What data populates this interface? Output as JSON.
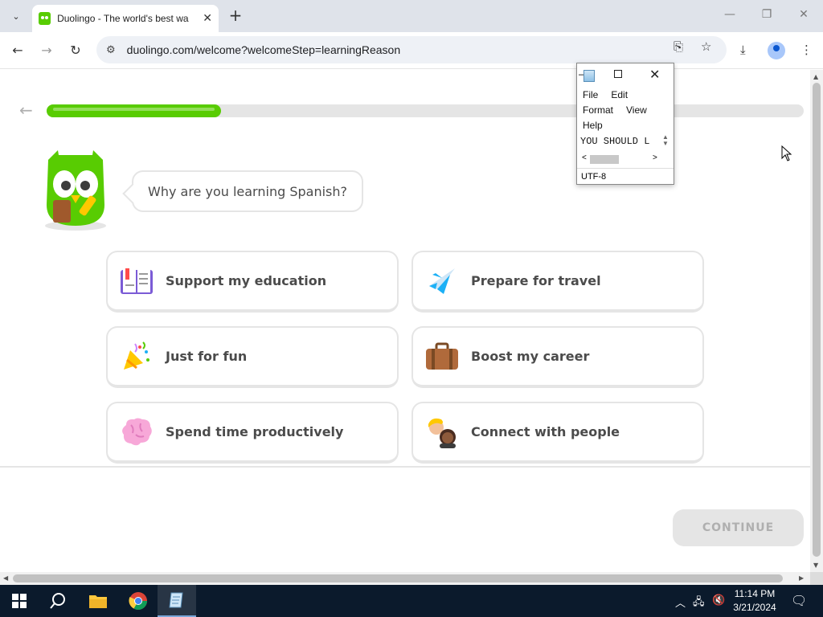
{
  "browser": {
    "tab_title": "Duolingo - The world's best wa",
    "tab_close": "✕",
    "new_tab": "+",
    "url": "duolingo.com/welcome?welcomeStep=learningReason"
  },
  "page": {
    "question": "Why are you learning Spanish?",
    "progress_percent": 23,
    "options": [
      {
        "label": "Support my education",
        "icon": "book-icon"
      },
      {
        "label": "Prepare for travel",
        "icon": "airplane-icon"
      },
      {
        "label": "Just for fun",
        "icon": "party-popper-icon"
      },
      {
        "label": "Boost my career",
        "icon": "briefcase-icon"
      },
      {
        "label": "Spend time productively",
        "icon": "brain-icon"
      },
      {
        "label": "Connect with people",
        "icon": "people-icon"
      }
    ],
    "continue_label": "CONTINUE"
  },
  "notepad": {
    "menu": [
      "File",
      "Edit",
      "Format",
      "View",
      "Help"
    ],
    "text": "YOU SHOULD L",
    "encoding": "UTF-8"
  },
  "taskbar": {
    "time": "11:14 PM",
    "date": "3/21/2024"
  },
  "colors": {
    "brand_green": "#58cc02",
    "border_gray": "#e5e5e5",
    "text_gray": "#4b4b4b",
    "disabled_text": "#afafaf"
  }
}
